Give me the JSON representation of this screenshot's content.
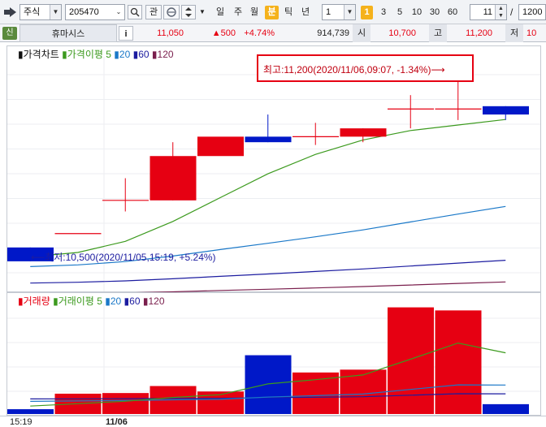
{
  "toolbar": {
    "market": "주식",
    "code": "205470",
    "fav_label": "관",
    "periods": [
      "일",
      "주",
      "월",
      "분",
      "틱",
      "년"
    ],
    "active_period": "분",
    "interval_value": "1",
    "one_label": "1",
    "minute_presets": [
      "3",
      "5",
      "10",
      "30",
      "60"
    ],
    "count_value": "11",
    "slash": "/",
    "total_value": "1200"
  },
  "info": {
    "badge": "신",
    "name": "휴마시스",
    "info_btn": "i",
    "price": "11,050",
    "change": "▲500",
    "change_pct": "+4.74%",
    "volume": "914,739",
    "open_label": "시",
    "open_value": "10,700",
    "high_label": "고",
    "high_value": "11,200",
    "low_label": "저",
    "low_value": "10"
  },
  "price_panel": {
    "legend_title": "가격차트",
    "legend_ma_label": "가격이평",
    "legend_periods": [
      "5",
      "20",
      "60",
      "120"
    ],
    "high_annotation": "최고:11,200(2020/11/06,09:07, -1.34%)⟶",
    "low_annotation": "⟵최저:10,500(2020/11/05,15:19, +5.24%)"
  },
  "volume_panel": {
    "legend_title": "거래량",
    "legend_ma_label": "거래이평",
    "legend_periods": [
      "5",
      "20",
      "60",
      "120"
    ]
  },
  "xaxis": {
    "labels": [
      "15:19",
      "11/06"
    ]
  },
  "colors": {
    "up": "#e60012",
    "down": "#0018c8",
    "ma5": "#3c9a1e",
    "ma20": "#1a78c8",
    "ma60": "#1c1ca0",
    "ma120": "#7a1f4d",
    "highlight": "#f5b21b"
  },
  "chart_data": {
    "type": "candlestick",
    "price_candles": [
      {
        "open": 10550,
        "high": 10550,
        "low": 10500,
        "close": 10500
      },
      {
        "open": 10600,
        "high": 10600,
        "low": 10600,
        "close": 10600
      },
      {
        "open": 10720,
        "high": 10800,
        "low": 10680,
        "close": 10720
      },
      {
        "open": 10720,
        "high": 10930,
        "low": 10720,
        "close": 10880
      },
      {
        "open": 10880,
        "high": 10880,
        "low": 10880,
        "close": 10950
      },
      {
        "open": 10950,
        "high": 11030,
        "low": 10930,
        "close": 10930
      },
      {
        "open": 10950,
        "high": 11000,
        "low": 10920,
        "close": 10950
      },
      {
        "open": 10950,
        "high": 10980,
        "low": 10930,
        "close": 10980
      },
      {
        "open": 11050,
        "high": 11100,
        "low": 10980,
        "close": 11050
      },
      {
        "open": 11050,
        "high": 11200,
        "low": 11010,
        "close": 11050
      },
      {
        "open": 11060,
        "high": 11060,
        "low": 11010,
        "close": 11030
      }
    ],
    "volume": [
      22,
      93,
      96,
      128,
      103,
      269,
      190,
      203,
      488,
      474,
      45
    ]
  }
}
